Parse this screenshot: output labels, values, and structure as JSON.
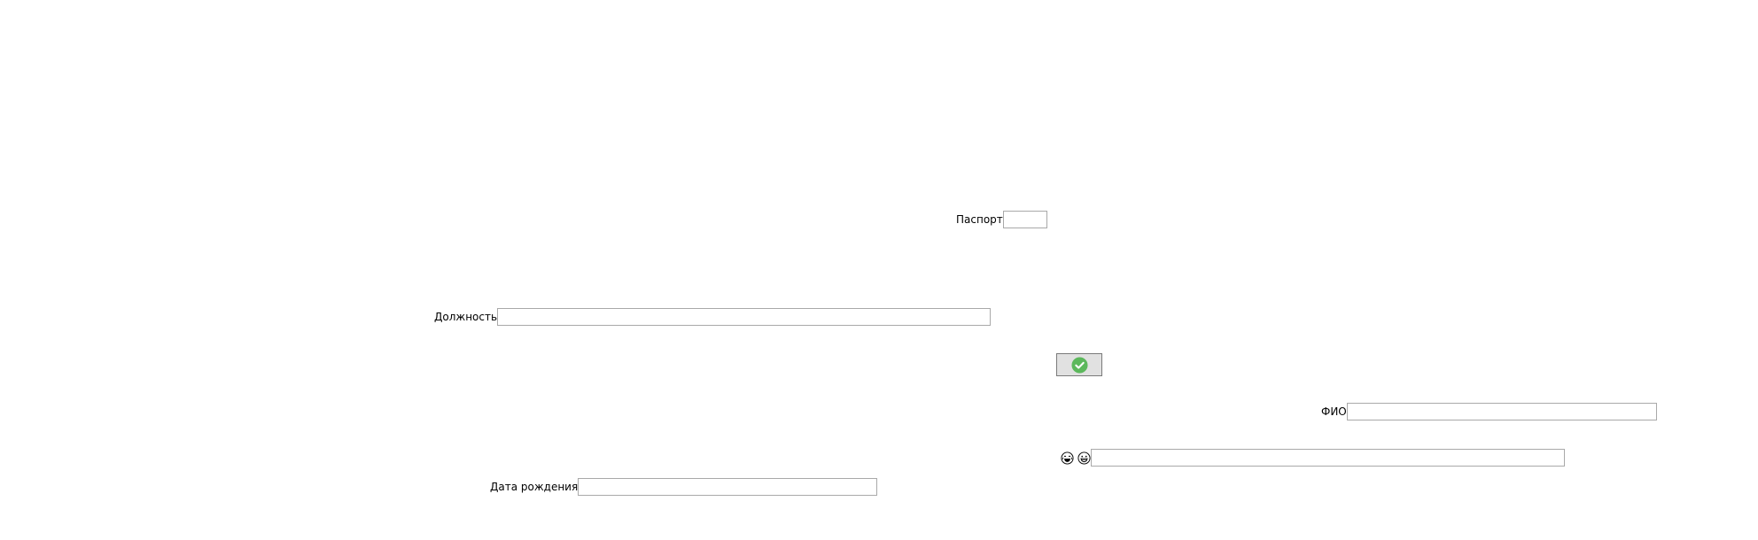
{
  "form": {
    "passport": {
      "label": "Паспорт",
      "value": "",
      "placeholder": ""
    },
    "position": {
      "label": "Должность",
      "value": "",
      "placeholder": ""
    },
    "fio": {
      "label": "ФИО",
      "value": "",
      "placeholder": ""
    },
    "emoji_field": {
      "value": "",
      "placeholder": "",
      "icons": [
        "laughing-face-icon",
        "grinning-face-icon"
      ]
    },
    "birth_date": {
      "label": "Дата рождения",
      "value": "",
      "placeholder": ""
    },
    "ok_button": {
      "icon": "checkmark-circle-icon",
      "color": "#5cb85c"
    }
  },
  "colors": {
    "background": "#ffffff",
    "field_border": "#a9a9a9",
    "button_face": "#e1e1e1",
    "button_border": "#7a7a7a",
    "check_green": "#5cb85c"
  }
}
